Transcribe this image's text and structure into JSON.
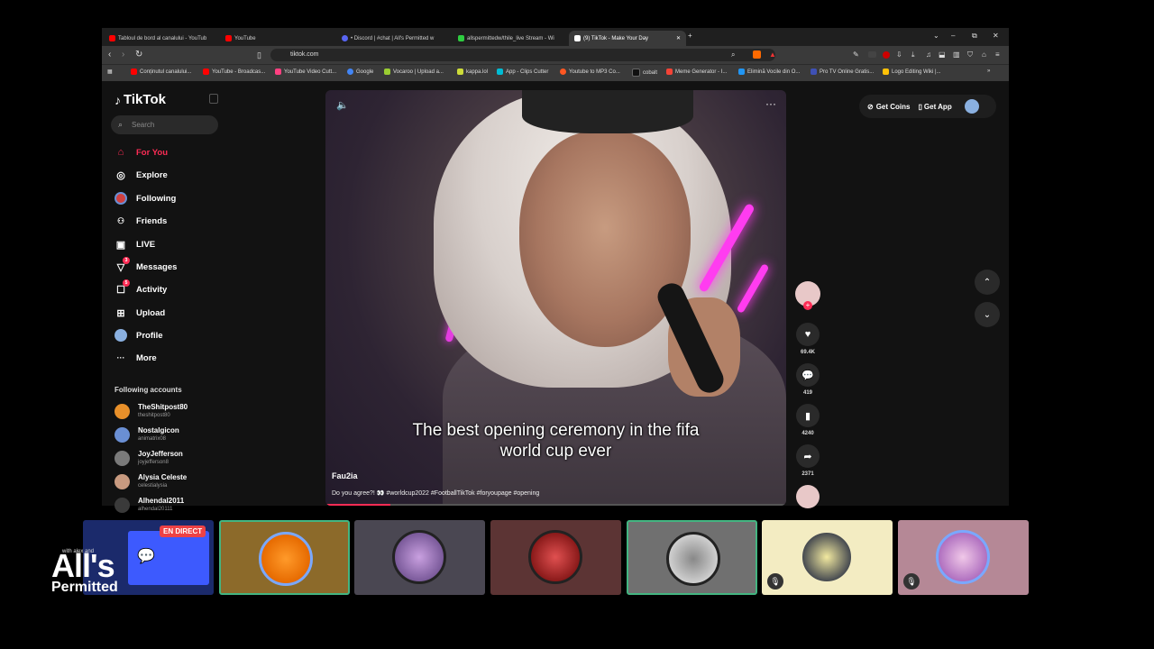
{
  "browser": {
    "tabs": [
      {
        "label": "Tabloul de bord al canalului - YouTub",
        "color": "#ff0000"
      },
      {
        "label": "YouTube",
        "color": "#ff0000"
      },
      {
        "label": "• Discord | #chat | All's Permitted w",
        "color": "#5865f2"
      },
      {
        "label": "allspermittedw/thile_live Stream - Wi",
        "color": "#2ecc40"
      },
      {
        "label": "(9) TikTok - Make Your Day",
        "color": "#ffffff",
        "active": true
      }
    ],
    "new_tab": "+",
    "window_controls": {
      "menu": "⌄",
      "minimize": "–",
      "restore": "⧉",
      "close": "✕"
    },
    "address": "tiktok.com",
    "bookmarks": [
      {
        "label": "Conținutul canalului...",
        "color": "#ff0000"
      },
      {
        "label": "YouTube - Broadcas...",
        "color": "#ff0000"
      },
      {
        "label": "YouTube Video Cutt...",
        "color": "#ff4081"
      },
      {
        "label": "Google",
        "color": "#4285f4"
      },
      {
        "label": "Vocaroo | Upload a...",
        "color": "#9acd32"
      },
      {
        "label": "kappa.lol",
        "color": "#cddc39"
      },
      {
        "label": "App - Clips Cutter",
        "color": "#00bcd4"
      },
      {
        "label": "Youtube to MP3 Co...",
        "color": "#ff5722"
      },
      {
        "label": "cobalt",
        "color": "#111111"
      },
      {
        "label": "Meme Generator - I...",
        "color": "#f44336"
      },
      {
        "label": "Elimină Vocile din O...",
        "color": "#2196f3"
      },
      {
        "label": "Pro TV Online Gratis...",
        "color": "#3f51b5"
      },
      {
        "label": "Logo Editing Wiki |...",
        "color": "#ffc107"
      }
    ],
    "more_bookmarks": "»"
  },
  "tiktok": {
    "logo": "TikTok",
    "search_placeholder": "Search",
    "nav": [
      {
        "label": "For You",
        "icon": "home-icon",
        "glyph": "⌂",
        "active": true
      },
      {
        "label": "Explore",
        "icon": "compass-icon",
        "glyph": "◎"
      },
      {
        "label": "Following",
        "icon": "following-avatar-icon",
        "glyph": "●"
      },
      {
        "label": "Friends",
        "icon": "friends-icon",
        "glyph": "👥"
      },
      {
        "label": "LIVE",
        "icon": "live-icon",
        "glyph": "▣"
      },
      {
        "label": "Messages",
        "icon": "messages-icon",
        "glyph": "✉",
        "badge": "3"
      },
      {
        "label": "Activity",
        "icon": "activity-icon",
        "glyph": "☐",
        "badge": "5"
      },
      {
        "label": "Upload",
        "icon": "upload-icon",
        "glyph": "⊞"
      },
      {
        "label": "Profile",
        "icon": "profile-icon",
        "glyph": "●"
      },
      {
        "label": "More",
        "icon": "more-icon",
        "glyph": "···"
      }
    ],
    "following_title": "Following accounts",
    "accounts": [
      {
        "name": "TheShitpost80",
        "handle": "theshitpost80",
        "color": "#e8902a"
      },
      {
        "name": "Nostalgicon",
        "handle": "animatrix08",
        "color": "#6a8fd4"
      },
      {
        "name": "JoyJefferson",
        "handle": "joyjefferson8",
        "color": "#7a7a7a"
      },
      {
        "name": "Alysia Celeste",
        "handle": "celestialysia",
        "color": "#c89a80"
      },
      {
        "name": "Alhendal2011",
        "handle": "alhendal20111",
        "color": "#3a3a3a"
      }
    ],
    "top_right": {
      "coins": "Get Coins",
      "app": "Get App"
    },
    "video": {
      "subtitle_line1": "The best opening ceremony in the fifa",
      "subtitle_line2": "world cup ever",
      "author": "Fau2ia",
      "description": "Do you agree?! 👀 #worldcup2022 #FootballTikTok #foryoupage #opening",
      "progress": 0.14
    },
    "actions": {
      "likes": "69.4K",
      "comments": "419",
      "saves": "4240",
      "shares": "2371"
    }
  },
  "discord_strip": {
    "live_badge": "EN DIRECT",
    "tiles": [
      {
        "bg": "#1b2a6b",
        "speaking": false,
        "muted": false,
        "avatar": "#3d5afe",
        "kind": "screen"
      },
      {
        "bg": "#8c6a2a",
        "speaking": true,
        "muted": false,
        "avatar": "#ff8c1a"
      },
      {
        "bg": "#4a4752",
        "speaking": false,
        "muted": false,
        "avatar": "#7a5a9a"
      },
      {
        "bg": "#5c3434",
        "speaking": false,
        "muted": false,
        "avatar": "#c0392b"
      },
      {
        "bg": "#707070",
        "speaking": true,
        "muted": false,
        "avatar": "#c8c8c8"
      },
      {
        "bg": "#f3ecc2",
        "speaking": false,
        "muted": true,
        "avatar": "#3a3f4a"
      },
      {
        "bg": "#b58896",
        "speaking": false,
        "muted": true,
        "avatar": "#d8a0d0"
      }
    ]
  },
  "branding": {
    "top": "with alex and",
    "line1": "All's",
    "line2": "Permitted"
  }
}
